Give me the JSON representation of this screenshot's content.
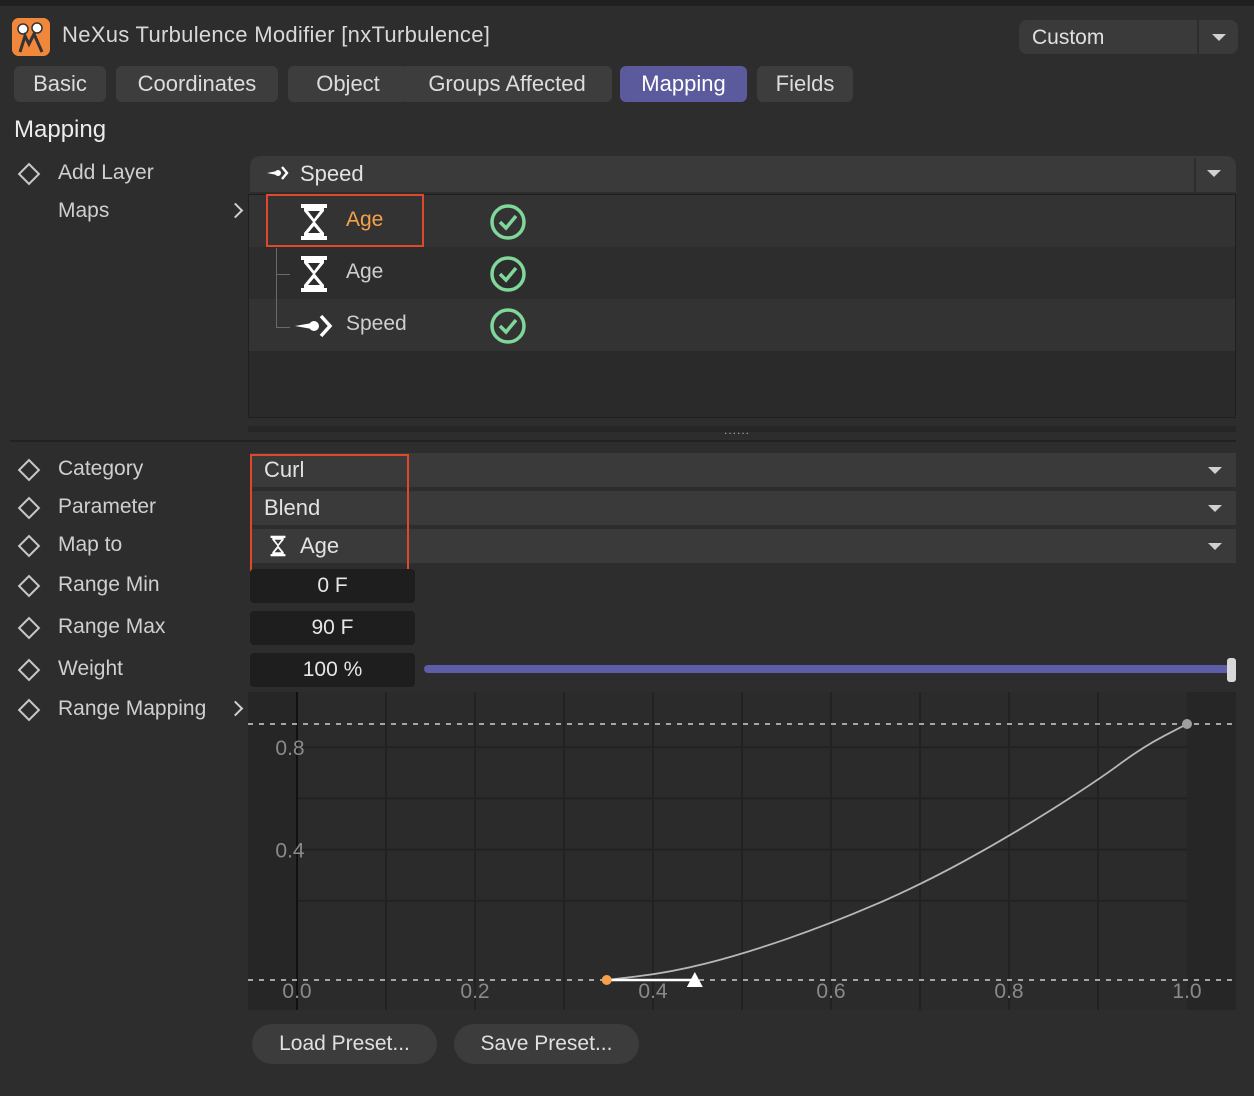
{
  "header": {
    "title": "NeXus Turbulence Modifier [nxTurbulence]",
    "preset": "Custom",
    "app_icon": "nexus-logo-icon"
  },
  "tabs": [
    {
      "label": "Basic",
      "active": false
    },
    {
      "label": "Coordinates",
      "active": false
    },
    {
      "label": "Object",
      "active": false
    },
    {
      "label": "Groups Affected",
      "active": false
    },
    {
      "label": "Mapping",
      "active": true
    },
    {
      "label": "Fields",
      "active": false
    }
  ],
  "section": {
    "title": "Mapping"
  },
  "add_layer": {
    "label": "Add Layer",
    "value": "Speed",
    "icon": "speed-arrow-icon"
  },
  "maps": {
    "label": "Maps",
    "items": [
      {
        "name": "Age",
        "icon": "hourglass-icon",
        "enabled": true,
        "selected": true
      },
      {
        "name": "Age",
        "icon": "hourglass-icon",
        "enabled": true,
        "selected": false
      },
      {
        "name": "Speed",
        "icon": "speed-arrow-icon",
        "enabled": true,
        "selected": false
      }
    ]
  },
  "splitter_dots": "......",
  "fields": {
    "category": {
      "label": "Category",
      "value": "Curl"
    },
    "parameter": {
      "label": "Parameter",
      "value": "Blend"
    },
    "map_to": {
      "label": "Map to",
      "value": "Age",
      "icon": "hourglass-icon"
    },
    "range_min": {
      "label": "Range Min",
      "value": "0 F"
    },
    "range_max": {
      "label": "Range Max",
      "value": "90 F"
    },
    "weight": {
      "label": "Weight",
      "value": "100 %",
      "level": 1.0
    },
    "range_mapping": {
      "label": "Range Mapping"
    }
  },
  "colors": {
    "accent": "#5a5a9c",
    "selected_text": "#f5a14a",
    "check": "#7fd89a",
    "highlight_box": "#e0482c"
  },
  "chart_data": {
    "type": "line",
    "x_ticks": [
      "0.0",
      "0.2",
      "0.4",
      "0.6",
      "0.8",
      "1.0"
    ],
    "y_ticks": [
      "0.0",
      "0.4",
      "0.8"
    ],
    "xlim": [
      0.0,
      1.0
    ],
    "ylim": [
      0.0,
      1.0
    ],
    "points": [
      [
        0.348,
        0.0
      ],
      [
        1.0,
        1.0
      ]
    ],
    "curve": [
      [
        0.348,
        0.0
      ],
      [
        0.42,
        0.03
      ],
      [
        0.5,
        0.1
      ],
      [
        0.6,
        0.22
      ],
      [
        0.7,
        0.37
      ],
      [
        0.8,
        0.56
      ],
      [
        0.9,
        0.78
      ],
      [
        0.95,
        0.91
      ],
      [
        1.0,
        1.0
      ]
    ],
    "tangent_handle": [
      0.447,
      0.0
    ],
    "grid": true
  },
  "buttons": {
    "load": "Load Preset...",
    "save": "Save Preset..."
  }
}
